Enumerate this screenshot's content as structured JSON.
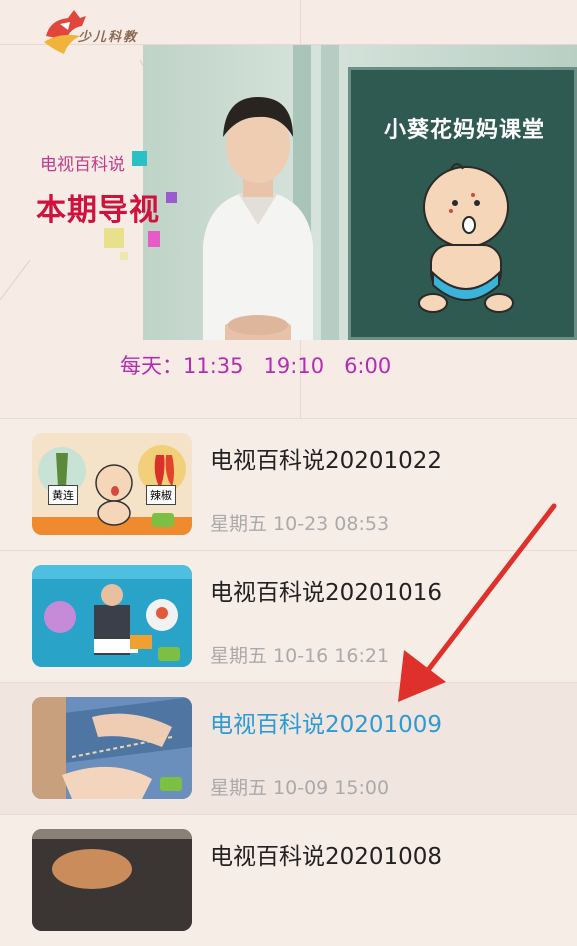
{
  "header": {
    "logo_text": "少儿科教",
    "board_title": "小葵花妈妈课堂",
    "program_subtitle": "电视百科说",
    "program_title": "本期导视",
    "schedule": {
      "label": "每天：",
      "times": [
        "11:35",
        "19:10",
        "6:00"
      ]
    }
  },
  "episodes": [
    {
      "title": "电视百科说20201022",
      "date": "星期五 10-23 08:53",
      "thumb_labels": [
        "黄连",
        "辣椒"
      ],
      "active": false
    },
    {
      "title": "电视百科说20201016",
      "date": "星期五 10-16 16:21",
      "active": false
    },
    {
      "title": "电视百科说20201009",
      "date": "星期五 10-09 15:00",
      "active": true
    },
    {
      "title": "电视百科说20201008",
      "date": "",
      "active": false
    }
  ],
  "colors": {
    "background": "#f6ede6",
    "accent_title": "#d0103d",
    "accent_schedule": "#b62bb3",
    "active_link": "#2c9ad6",
    "annotation_arrow": "#e0302c"
  }
}
